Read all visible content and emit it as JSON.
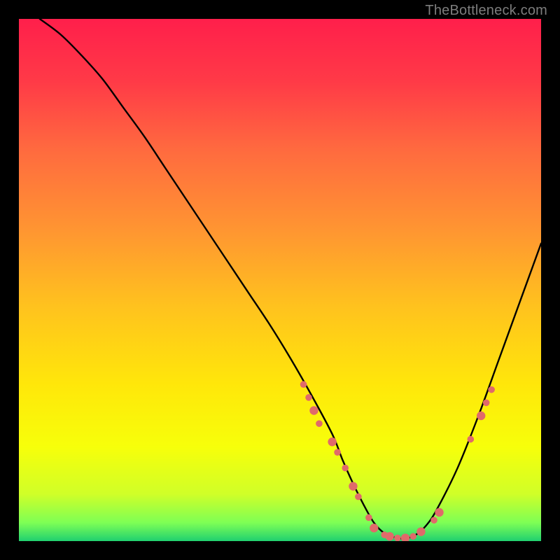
{
  "watermark": "TheBottleneck.com",
  "gradient": {
    "stops": [
      {
        "offset": 0.0,
        "color": "#ff1f4b"
      },
      {
        "offset": 0.12,
        "color": "#ff3a47"
      },
      {
        "offset": 0.25,
        "color": "#ff6a3f"
      },
      {
        "offset": 0.4,
        "color": "#ff9432"
      },
      {
        "offset": 0.55,
        "color": "#ffc21e"
      },
      {
        "offset": 0.7,
        "color": "#ffe70a"
      },
      {
        "offset": 0.82,
        "color": "#f7ff0a"
      },
      {
        "offset": 0.91,
        "color": "#d0ff28"
      },
      {
        "offset": 0.965,
        "color": "#7dff55"
      },
      {
        "offset": 1.0,
        "color": "#20d070"
      }
    ]
  },
  "chart_data": {
    "type": "line",
    "title": "",
    "xlabel": "",
    "ylabel": "",
    "xlim": [
      0,
      100
    ],
    "ylim": [
      0,
      100
    ],
    "grid": false,
    "series": [
      {
        "name": "curve",
        "color": "#000000",
        "x": [
          4,
          8,
          12,
          16,
          20,
          24,
          28,
          32,
          36,
          40,
          44,
          48,
          52,
          56,
          60,
          62,
          64,
          66,
          68,
          70,
          72,
          74,
          76,
          78,
          80,
          84,
          88,
          92,
          96,
          100
        ],
        "y": [
          100,
          97,
          93,
          88.5,
          83,
          77.5,
          71.5,
          65.5,
          59.5,
          53.5,
          47.5,
          41.5,
          35,
          28,
          20.5,
          15.5,
          11,
          7,
          3.5,
          1.5,
          0.7,
          0.5,
          1.2,
          3,
          6,
          14,
          24,
          35,
          46,
          57
        ]
      }
    ],
    "markers": {
      "color": "#e06a6a",
      "radius_small": 4.8,
      "radius_large": 6.2,
      "points": [
        {
          "x": 54.5,
          "y": 30.0,
          "r": "small"
        },
        {
          "x": 55.5,
          "y": 27.5,
          "r": "small"
        },
        {
          "x": 56.5,
          "y": 25.0,
          "r": "large"
        },
        {
          "x": 57.5,
          "y": 22.5,
          "r": "small"
        },
        {
          "x": 60.0,
          "y": 19.0,
          "r": "large"
        },
        {
          "x": 61.0,
          "y": 17.0,
          "r": "small"
        },
        {
          "x": 62.5,
          "y": 14.0,
          "r": "small"
        },
        {
          "x": 64.0,
          "y": 10.5,
          "r": "large"
        },
        {
          "x": 65.0,
          "y": 8.5,
          "r": "small"
        },
        {
          "x": 67.0,
          "y": 4.5,
          "r": "small"
        },
        {
          "x": 68.0,
          "y": 2.5,
          "r": "large"
        },
        {
          "x": 70.0,
          "y": 1.2,
          "r": "small"
        },
        {
          "x": 71.0,
          "y": 0.9,
          "r": "large"
        },
        {
          "x": 72.5,
          "y": 0.6,
          "r": "small"
        },
        {
          "x": 74.0,
          "y": 0.6,
          "r": "large"
        },
        {
          "x": 75.5,
          "y": 0.9,
          "r": "small"
        },
        {
          "x": 77.0,
          "y": 1.8,
          "r": "large"
        },
        {
          "x": 79.5,
          "y": 4.0,
          "r": "small"
        },
        {
          "x": 80.5,
          "y": 5.5,
          "r": "large"
        },
        {
          "x": 86.5,
          "y": 19.5,
          "r": "small"
        },
        {
          "x": 88.5,
          "y": 24.0,
          "r": "large"
        },
        {
          "x": 89.5,
          "y": 26.5,
          "r": "small"
        },
        {
          "x": 90.5,
          "y": 29.0,
          "r": "small"
        }
      ]
    }
  }
}
